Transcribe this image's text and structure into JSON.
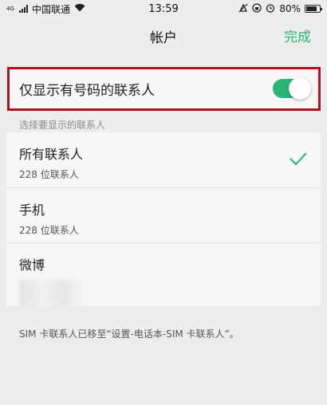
{
  "status_bar": {
    "signal_badge": "4G",
    "carrier": "中国联通",
    "time": "13:59",
    "battery_percent": "80%",
    "battery_level": 0.8
  },
  "nav": {
    "title": "帐户",
    "done_label": "完成"
  },
  "toggle": {
    "label": "仅显示有号码的联系人",
    "on": true
  },
  "section_header": "选择要显示的联系人",
  "list": {
    "items": [
      {
        "name": "所有联系人",
        "count": "228 位联系人",
        "selected": true
      },
      {
        "name": "手机",
        "count": "228 位联系人",
        "selected": false
      },
      {
        "name": "微博",
        "count": "",
        "selected": false
      }
    ]
  },
  "footer_note": "SIM 卡联系人已移至“设置-电话本-SIM 卡联系人”。",
  "colors": {
    "accent": "#2bb673",
    "highlight": "#b2121e",
    "background": "#ededed"
  }
}
